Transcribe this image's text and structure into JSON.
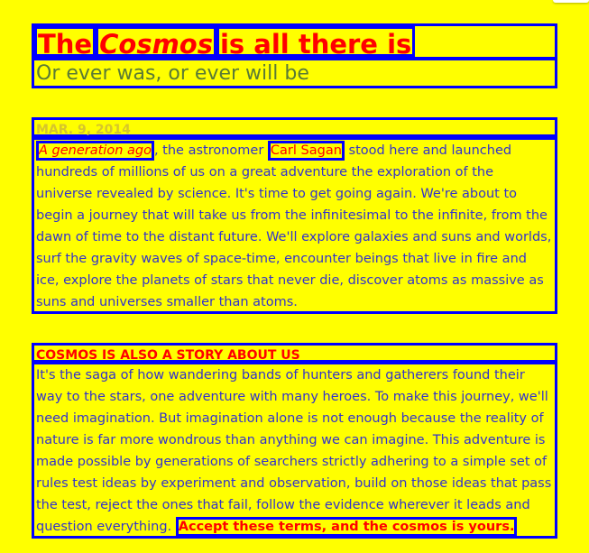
{
  "header": {
    "title_parts": [
      "The",
      "Cosmos",
      "is all there is"
    ],
    "subtitle": "Or ever was, or ever will be"
  },
  "article1": {
    "date": "MAR. 9, 2014",
    "link1": "A generation ago",
    "text1": ", the astronomer ",
    "link2": "Carl Sagan",
    "text2": " stood here and launched hundreds of millions of us on a great adventure the exploration of the universe revealed by science. It's time to get going again. We're about to begin a journey that will take us from the infinitesimal to the infinite, from the dawn of time to the distant future. We'll explore galaxies and suns and worlds, surf the gravity waves of space-time, encounter beings that live in fire and ice, explore the planets of stars that never die, discover atoms as massive as suns and universes smaller than atoms."
  },
  "article2": {
    "heading": "COSMOS IS ALSO A STORY ABOUT US",
    "body": "It's the saga of how wandering bands of hunters and gatherers found their way to the stars, one adventure with many heroes. To make this journey, we'll need imagination. But imagination alone is not enough because the reality of nature is far more wondrous than anything we can imagine. This adventure is made possible by generations of searchers strictly adhering to a simple set of rules test ideas by experiment and observation, build on those ideas that pass the test, reject the ones that fail, follow the evidence wherever it leads and question everything. ",
    "cta": "Accept these terms, and the cosmos is yours."
  }
}
